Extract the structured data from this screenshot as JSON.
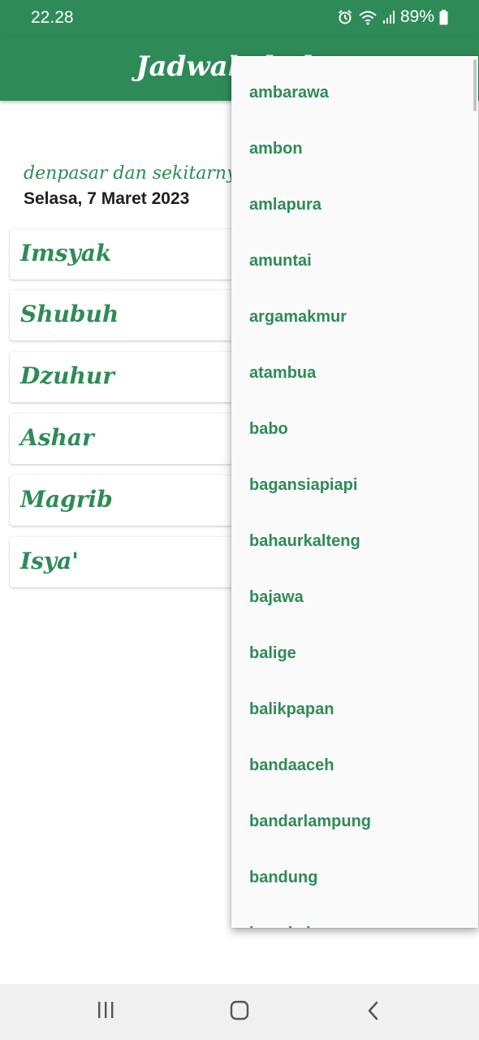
{
  "status_bar": {
    "time": "22.28",
    "battery": "89%",
    "icons": [
      "alarm-icon",
      "wifi-icon",
      "signal-icon",
      "battery-icon"
    ]
  },
  "app_bar": {
    "title": "Jadwal sholat"
  },
  "location": "denpasar dan sekitarnya",
  "date": "Selasa, 7 Maret 2023",
  "prayers": [
    {
      "name": "Imsyak"
    },
    {
      "name": "Shubuh"
    },
    {
      "name": "Dzuhur"
    },
    {
      "name": "Ashar"
    },
    {
      "name": "Magrib"
    },
    {
      "name": "Isya'"
    }
  ],
  "dropdown": {
    "items": [
      "ambarawa",
      "ambon",
      "amlapura",
      "amuntai",
      "argamakmur",
      "atambua",
      "babo",
      "bagansiapiapi",
      "bahaurkalteng",
      "bajawa",
      "balige",
      "balikpapan",
      "bandaaceh",
      "bandarlampung",
      "bandung",
      "bangkalan"
    ]
  },
  "colors": {
    "primary": "#2e8b57",
    "text_dark": "#1f1f1f",
    "menu_bg": "#fafafa"
  },
  "nav_bar": {
    "buttons": [
      "recent-apps-icon",
      "home-icon",
      "back-icon"
    ]
  }
}
